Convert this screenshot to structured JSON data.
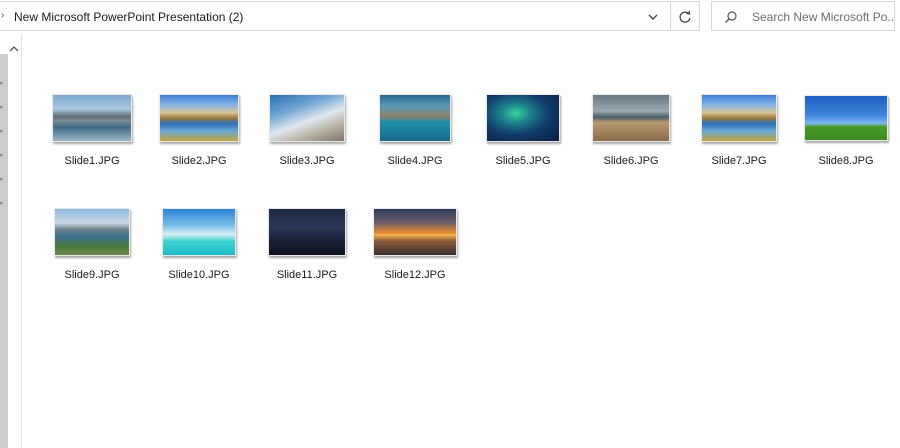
{
  "address_bar": {
    "path": "New Microsoft PowerPoint Presentation (2)"
  },
  "search": {
    "placeholder": "Search New Microsoft Po..."
  },
  "files": [
    {
      "name": "Slide1.JPG",
      "thumbnail": "lake-mountains"
    },
    {
      "name": "Slide2.JPG",
      "thumbnail": "alpine-lake-meadow"
    },
    {
      "name": "Slide3.JPG",
      "thumbnail": "rocky-coast-clouds"
    },
    {
      "name": "Slide4.JPG",
      "thumbnail": "turquoise-mountain-lake"
    },
    {
      "name": "Slide5.JPG",
      "thumbnail": "northern-lights"
    },
    {
      "name": "Slide6.JPG",
      "thumbnail": "wooden-pier-lake"
    },
    {
      "name": "Slide7.JPG",
      "thumbnail": "alpine-lake-meadow"
    },
    {
      "name": "Slide8.JPG",
      "thumbnail": "green-field-blue-sky"
    },
    {
      "name": "Slide9.JPG",
      "thumbnail": "mountain-lake-town"
    },
    {
      "name": "Slide10.JPG",
      "thumbnail": "tropical-beach"
    },
    {
      "name": "Slide11.JPG",
      "thumbnail": "night-sky-lake"
    },
    {
      "name": "Slide12.JPG",
      "thumbnail": "sunset-lake"
    }
  ],
  "icons": {
    "dropdown": "chevron-down-icon",
    "refresh": "refresh-icon",
    "search": "search-icon"
  }
}
